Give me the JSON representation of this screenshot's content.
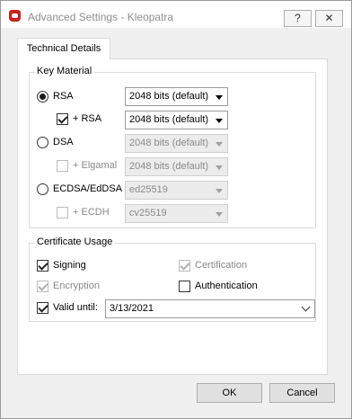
{
  "window": {
    "title": "Advanced Settings - Kleopatra",
    "help_label": "?",
    "close_label": "✕"
  },
  "tabs": [
    {
      "label": "Technical Details"
    }
  ],
  "key_material": {
    "title": "Key Material",
    "rsa": {
      "label": "RSA",
      "selected": true,
      "value": "2048 bits (default)"
    },
    "rsa_sub": {
      "label": "+ RSA",
      "checked": true,
      "value": "2048 bits (default)"
    },
    "dsa": {
      "label": "DSA",
      "selected": false,
      "value": "2048 bits (default)"
    },
    "elgamal": {
      "label": "+ Elgamal",
      "checked": false,
      "value": "2048 bits (default)"
    },
    "ecdsa": {
      "label": "ECDSA/EdDSA",
      "selected": false,
      "value": "ed25519"
    },
    "ecdh": {
      "label": "+ ECDH",
      "checked": false,
      "value": "cv25519"
    }
  },
  "certificate_usage": {
    "title": "Certificate Usage",
    "signing": {
      "label": "Signing",
      "checked": true
    },
    "certification": {
      "label": "Certification",
      "checked": true
    },
    "encryption": {
      "label": "Encryption",
      "checked": true
    },
    "authentication": {
      "label": "Authentication",
      "checked": false
    },
    "valid_until": {
      "label": "Valid until:",
      "checked": true,
      "value": "3/13/2021"
    }
  },
  "buttons": {
    "ok": "OK",
    "cancel": "Cancel"
  },
  "colors": {
    "app_icon": "#c8221c",
    "dialog_bg": "#f0f0f0",
    "panel_bg": "#ffffff"
  }
}
